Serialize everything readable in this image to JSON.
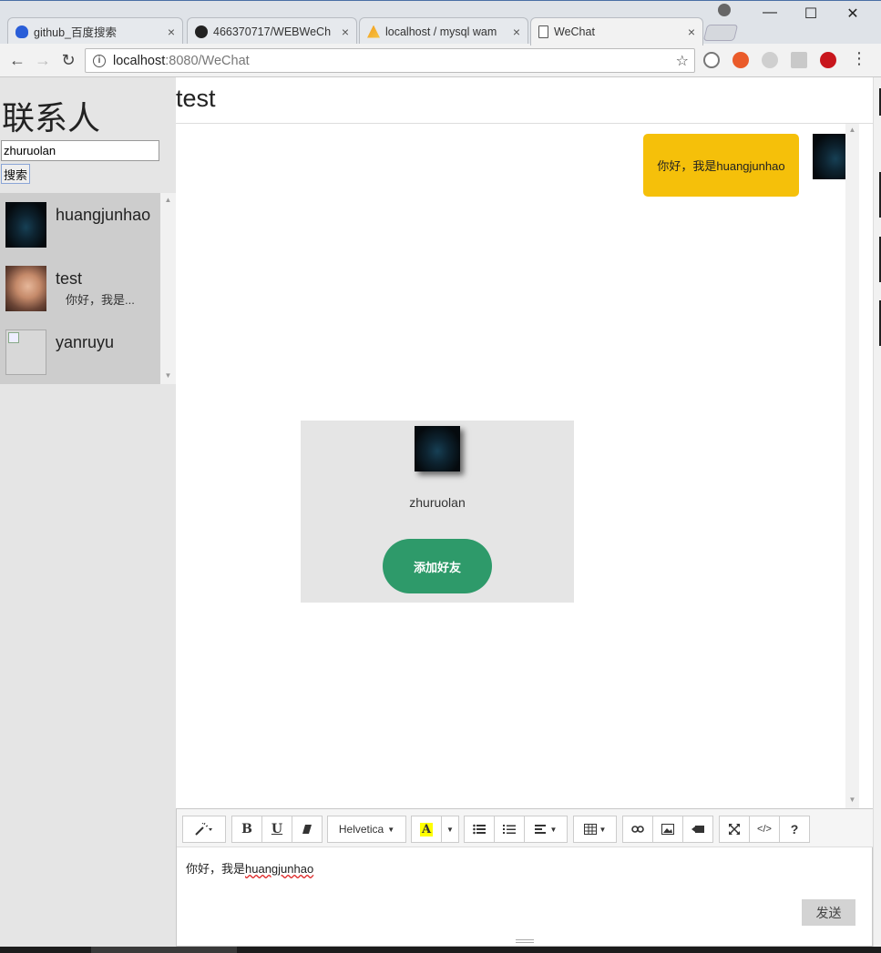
{
  "browser": {
    "tabs": [
      {
        "title": "github_百度搜索",
        "icon": "baidu-paw-icon",
        "close": "×"
      },
      {
        "title": "466370717/WEBWeCh",
        "icon": "github-icon",
        "close": "×"
      },
      {
        "title": "localhost / mysql wam",
        "icon": "phpmyadmin-icon",
        "close": "×"
      },
      {
        "title": "WeChat",
        "icon": "page-icon",
        "close": "×"
      }
    ],
    "window_controls": {
      "minimize": "—",
      "maximize": "☐",
      "close": "✕"
    },
    "nav": {
      "back": "←",
      "forward": "→",
      "reload": "↻"
    },
    "url": {
      "host": "localhost",
      "rest": ":8080/WeChat"
    },
    "star": "☆",
    "menu": "⋮"
  },
  "sidebar": {
    "title": "联系人",
    "search_value": "zhuruolan",
    "search_button": "搜索",
    "contacts": [
      {
        "name": "huangjunhao",
        "preview": ""
      },
      {
        "name": "test",
        "preview": "你好，我是..."
      },
      {
        "name": "yanruyu",
        "preview": ""
      }
    ]
  },
  "chat": {
    "title": "test",
    "messages": [
      {
        "text": "你好，我是huangjunhao",
        "from": "self"
      }
    ],
    "search_result": {
      "name": "zhuruolan",
      "add_button": "添加好友"
    }
  },
  "editor": {
    "font_name": "Helvetica",
    "text_prefix": "你好，我是",
    "text_name": "huangjunhao",
    "send_button": "发送",
    "tools": {
      "bold": "B",
      "underline": "U",
      "font_color": "A",
      "code": "</>",
      "help": "?"
    }
  },
  "colors": {
    "bubble": "#f5c00a",
    "add_button": "#2e9a6a",
    "sidebar_bg": "#e5e5e5",
    "contact_list_bg": "#cdcdcd"
  }
}
